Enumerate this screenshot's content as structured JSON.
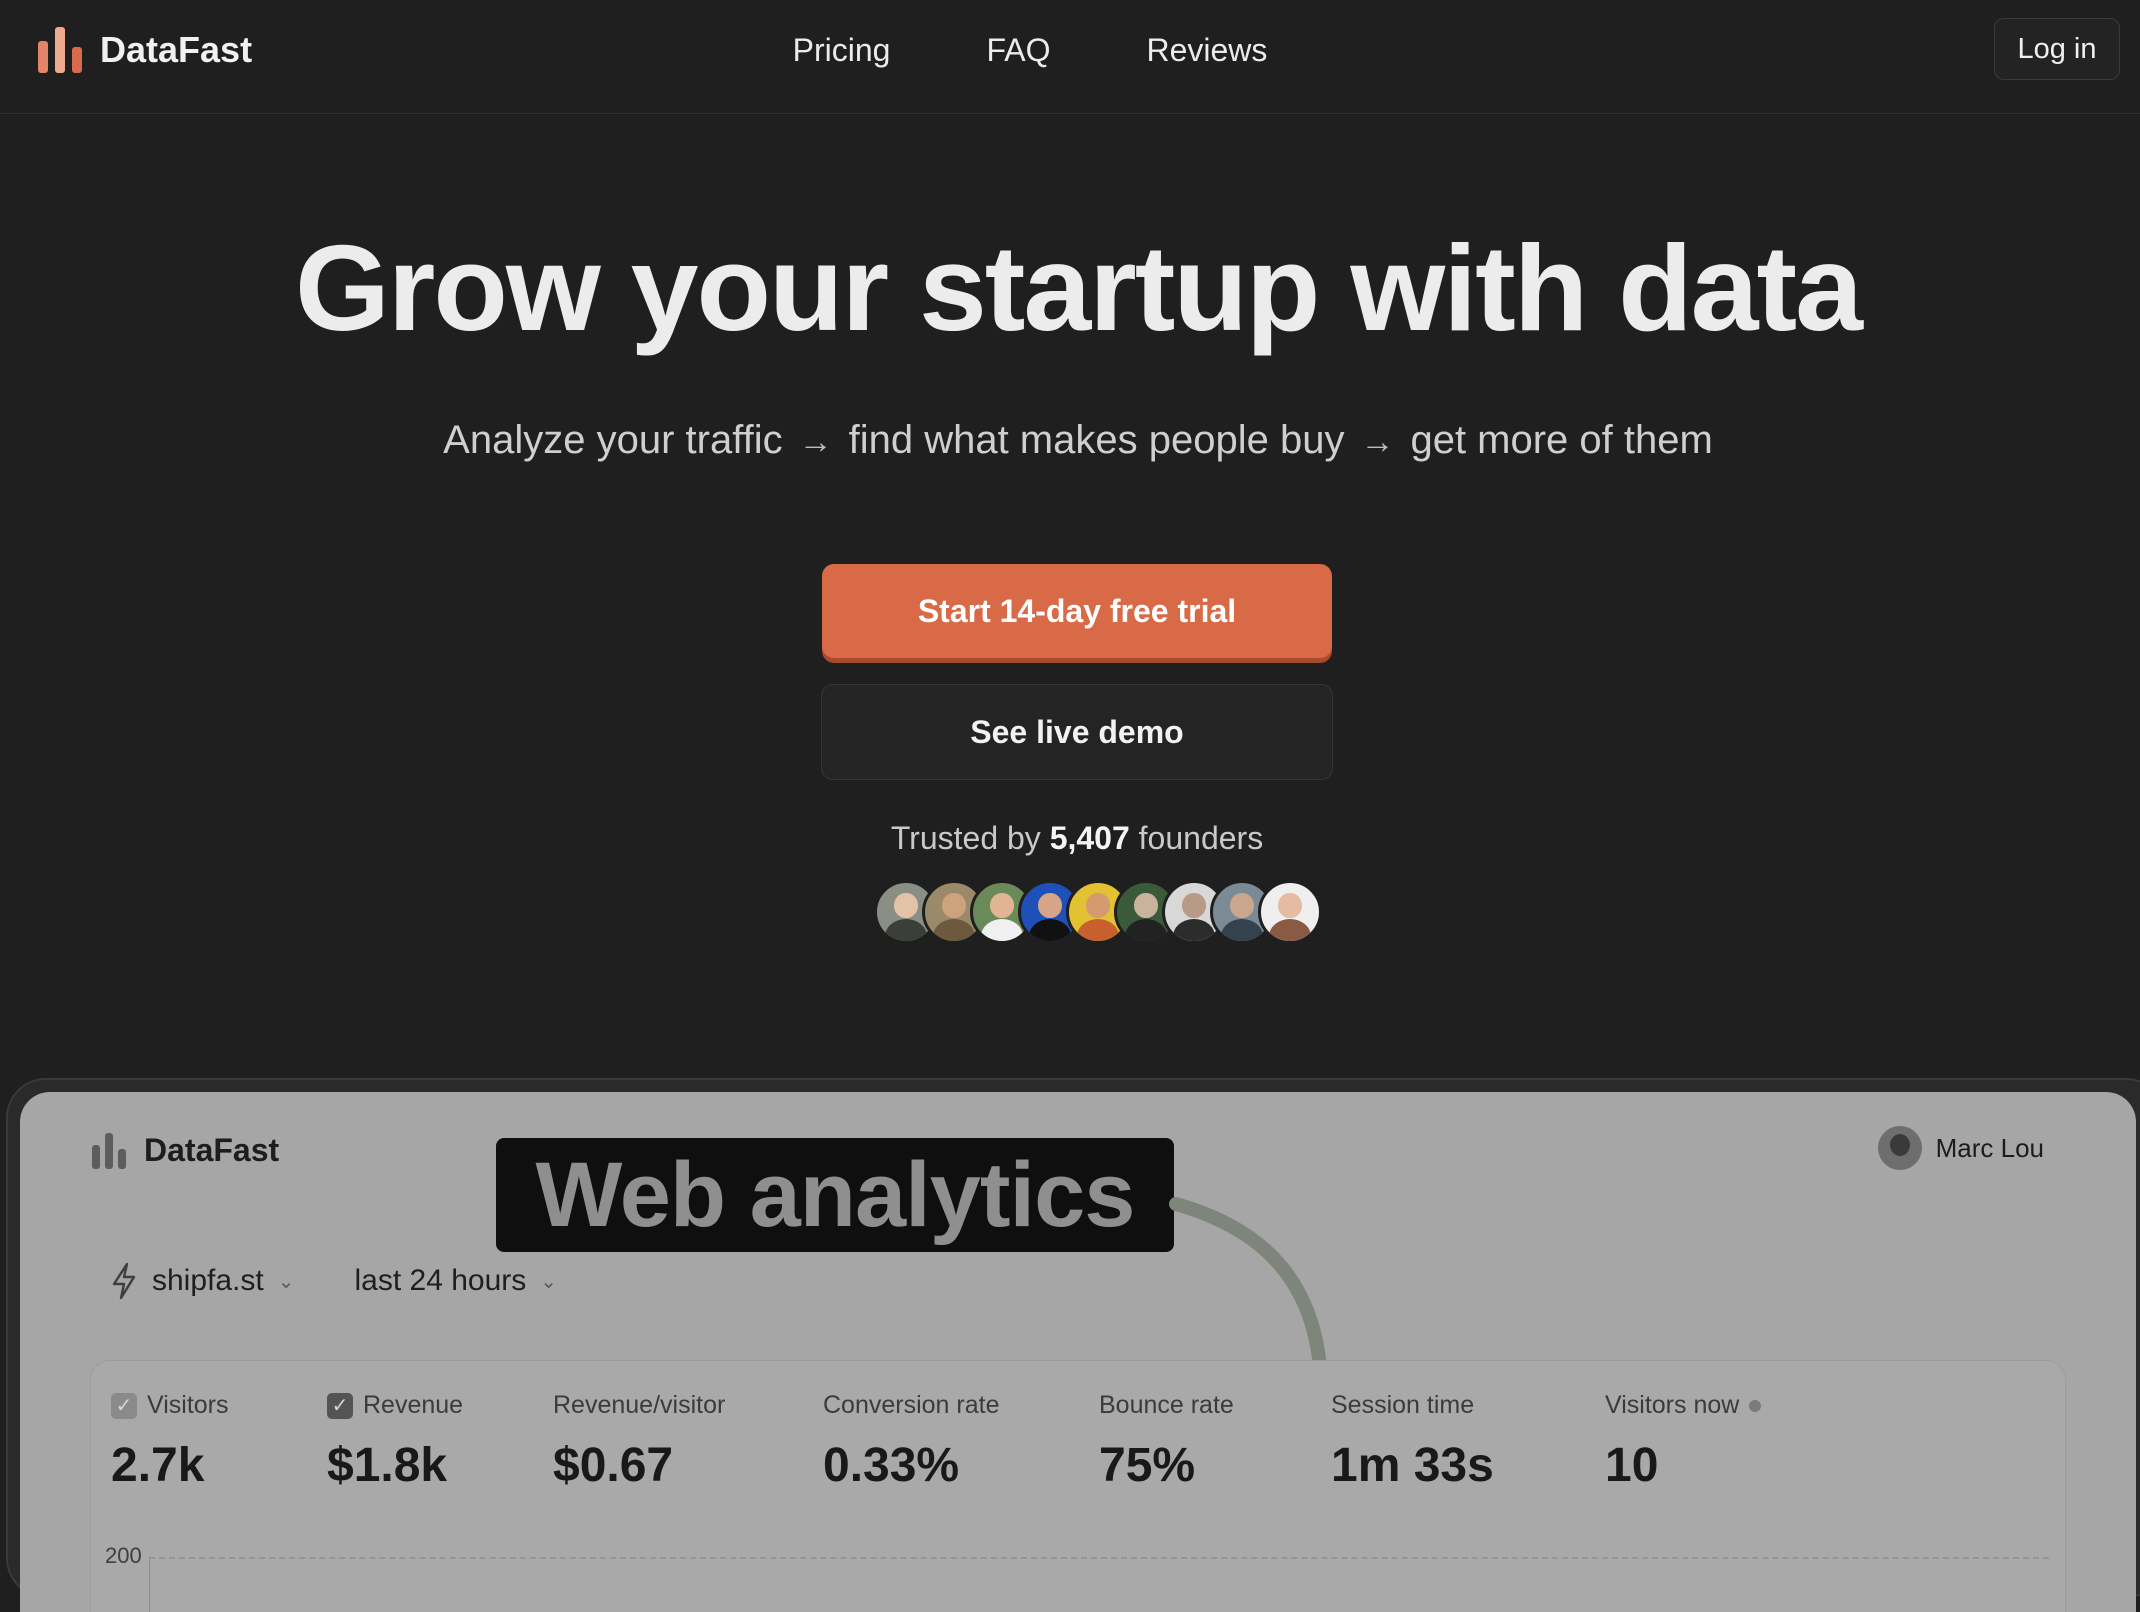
{
  "header": {
    "brand": "DataFast",
    "nav": [
      "Pricing",
      "FAQ",
      "Reviews"
    ],
    "login": "Log in"
  },
  "hero": {
    "title": "Grow your startup with data",
    "subtitle_parts": [
      "Analyze your traffic",
      "find what makes people buy",
      "get more of them"
    ],
    "arrow": "→",
    "cta_primary": "Start 14-day free trial",
    "cta_secondary": "See live demo",
    "trusted_prefix": "Trusted by",
    "trusted_count": "5,407",
    "trusted_suffix": "founders"
  },
  "preview": {
    "brand": "DataFast",
    "badge": "Web analytics",
    "user_name": "Marc Lou",
    "site": "shipfa.st",
    "range": "last 24 hours",
    "stats": [
      {
        "label": "Visitors",
        "value": "2.7k"
      },
      {
        "label": "Revenue",
        "value": "$1.8k"
      },
      {
        "label": "Revenue/visitor",
        "value": "$0.67"
      },
      {
        "label": "Conversion rate",
        "value": "0.33%"
      },
      {
        "label": "Bounce rate",
        "value": "75%"
      },
      {
        "label": "Session time",
        "value": "1m 33s"
      },
      {
        "label": "Visitors now",
        "value": "10"
      }
    ],
    "y_tick": "200"
  },
  "colors": {
    "accent": "#d96a47",
    "background": "#1f1f1f",
    "logo_bars": [
      "#e2836a",
      "#efa98f",
      "#d86b4e"
    ]
  },
  "icons": {
    "logo": "bar-chart-icon",
    "site": "bolt-icon",
    "dropdown": "chevron-down-icon",
    "checkbox": "check-icon",
    "live": "status-dot-icon"
  }
}
